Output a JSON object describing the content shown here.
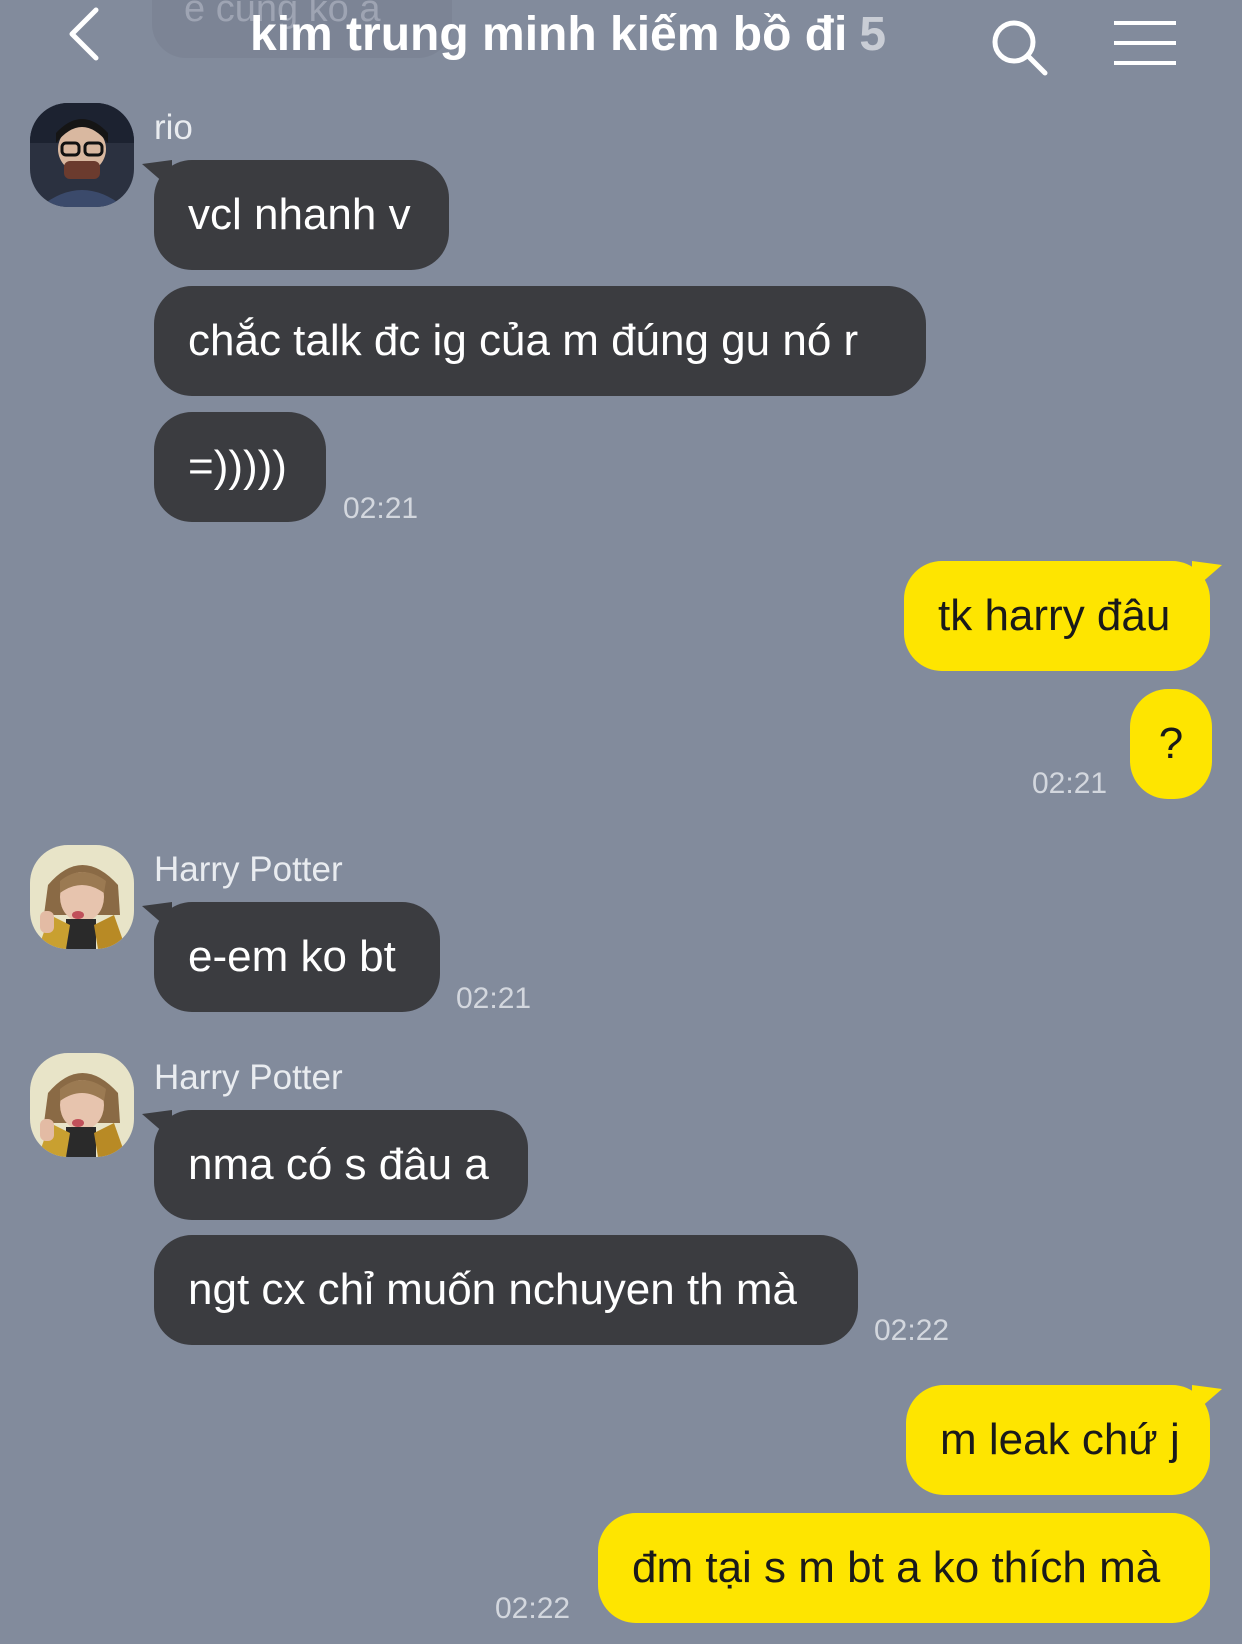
{
  "header": {
    "title": "kim trung minh kiếm bồ đi",
    "member_count": "5",
    "ghost_text": "e cũng ko a"
  },
  "colors": {
    "background": "#828b9c",
    "incoming_bubble": "#3b3c40",
    "outgoing_bubble": "#fee500"
  },
  "messages": [
    {
      "sender": "rio",
      "text": "vcl nhanh v",
      "direction": "incoming"
    },
    {
      "text": "chắc talk đc ig của m đúng gu nó r",
      "direction": "incoming"
    },
    {
      "text": "=)))))",
      "direction": "incoming",
      "time": "02:21"
    },
    {
      "text": "tk harry đâu",
      "direction": "outgoing"
    },
    {
      "text": "?",
      "direction": "outgoing",
      "time": "02:21"
    },
    {
      "sender": "Harry Potter",
      "text": "e-em ko bt",
      "direction": "incoming",
      "time": "02:21"
    },
    {
      "sender": "Harry Potter",
      "text": "nma có s đâu a",
      "direction": "incoming"
    },
    {
      "text": "ngt cx chỉ muốn nchuyen th mà",
      "direction": "incoming",
      "time": "02:22"
    },
    {
      "text": "m leak chứ j",
      "direction": "outgoing"
    },
    {
      "text": "đm tại s m bt a ko thích mà",
      "direction": "outgoing",
      "time": "02:22"
    }
  ]
}
